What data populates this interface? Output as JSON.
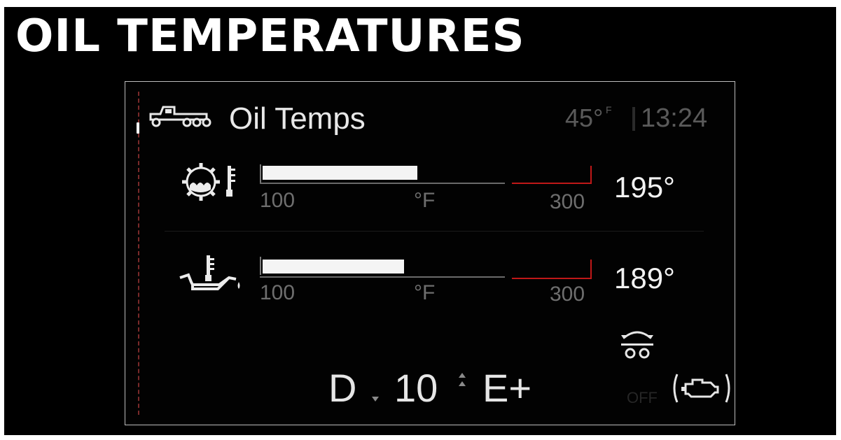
{
  "heading": "OIL TEMPERATURES",
  "screen": {
    "title": "Oil Temps",
    "outside_temp": "45°",
    "outside_temp_unit": "F",
    "clock": "13:24"
  },
  "gauges": [
    {
      "icon": "transmission-oil-temp-icon",
      "scale_min": "100",
      "scale_unit": "°F",
      "scale_max": "300",
      "value": "195°",
      "fill_fraction": 0.48
    },
    {
      "icon": "engine-oil-temp-icon",
      "scale_min": "100",
      "scale_unit": "°F",
      "scale_max": "300",
      "value": "189°",
      "fill_fraction": 0.44
    }
  ],
  "gear": {
    "mode": "D",
    "gear_number": "10",
    "range": "E+"
  },
  "engine_brake_label": "OFF",
  "icons": [
    "truck-icon",
    "axle-lift-icon",
    "engine-brake-icon",
    "gear-down-arrow-icon",
    "gear-up-arrow-icon"
  ],
  "colors": {
    "redline": "#c01818",
    "bar_fill": "#f4f4f4",
    "dim_text": "#6e6e6e"
  }
}
